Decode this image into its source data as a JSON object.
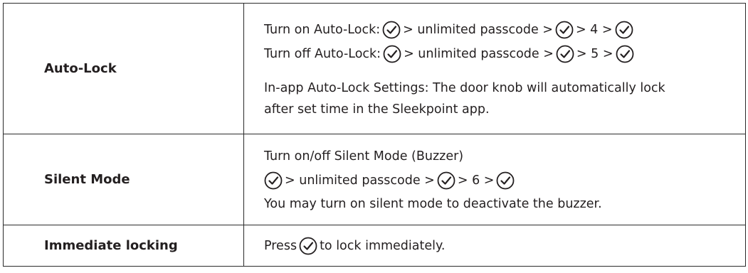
{
  "rows": [
    {
      "label": "Auto-Lock",
      "line1": {
        "pre": "Turn on Auto-Lock:",
        "mid1": "> unlimited passcode >",
        "mid2": "> 4 >"
      },
      "line2": {
        "pre": "Turn off Auto-Lock:",
        "mid1": "> unlimited passcode >",
        "mid2": "> 5 >"
      },
      "note1": "In-app Auto-Lock Settings: The door knob will automatically lock",
      "note2": "after set time in the Sleekpoint app."
    },
    {
      "label": "Silent Mode",
      "line1": "Turn on/off Silent Mode (Buzzer)",
      "line2": {
        "mid1": "> unlimited passcode >",
        "mid2": "> 6 >"
      },
      "line3": "You may turn on silent mode to deactivate the buzzer."
    },
    {
      "label": "Immediate locking",
      "pre": "Press",
      "post": "to lock immediately."
    }
  ],
  "icons": {
    "confirm": "check-circle-icon"
  }
}
